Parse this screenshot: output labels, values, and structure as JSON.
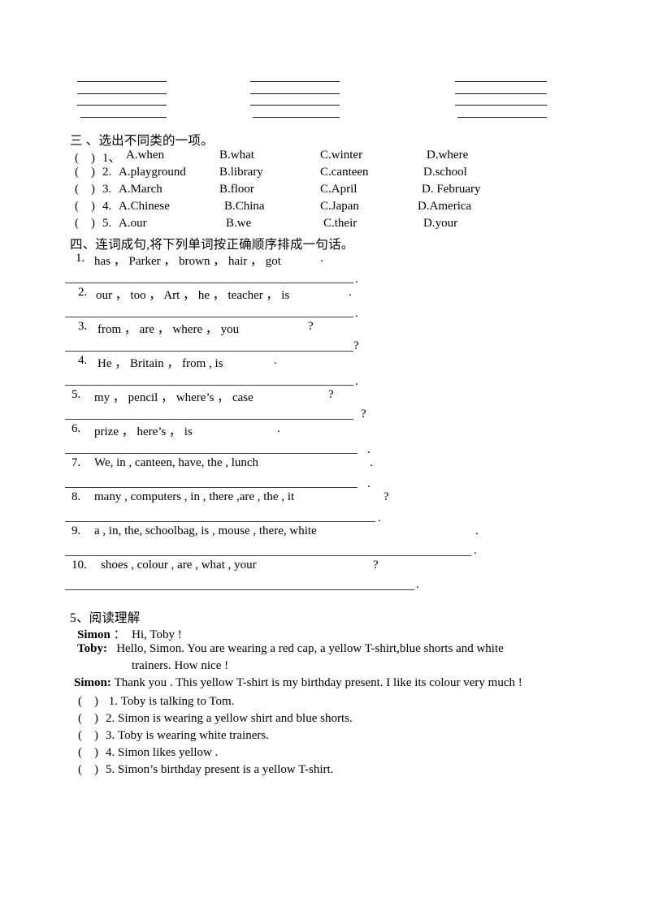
{
  "top_blank_lines": {
    "columns": 3,
    "lines_per_column": 4
  },
  "section_three": {
    "heading": "三 、选出不同类的一项。",
    "items": [
      {
        "paren": "(",
        "close": ")",
        "num": "1、",
        "options": [
          "A.when",
          "B.what",
          "C.winter",
          "D.where"
        ]
      },
      {
        "paren": "(",
        "close": ")",
        "num": "2.",
        "options": [
          "A.playground",
          "B.library",
          "C.canteen",
          "D.school"
        ]
      },
      {
        "paren": "(",
        "close": ")",
        "num": "3.",
        "options": [
          "A.March",
          "B.floor",
          "C.April",
          "D. February"
        ]
      },
      {
        "paren": "(",
        "close": ")",
        "num": "4.",
        "options": [
          "A.Chinese",
          "B.China",
          "C.Japan",
          "D.America"
        ]
      },
      {
        "paren": "(",
        "close": ")",
        "num": "5.",
        "options": [
          "A.our",
          "B.we",
          "C.their",
          "D.your"
        ]
      }
    ]
  },
  "section_four": {
    "heading": "四、连词成句,将下列单词按正确顺序排成一句话。",
    "items": [
      {
        "num": "1.",
        "words": "has ，  Parker  ，  brown  ，  hair  ，  got",
        "end": ".",
        "answer_punct": "."
      },
      {
        "num": "2.",
        "words": "our ，  too ，  Art  ， he ，  teacher ，  is",
        "end": ".",
        "answer_punct": "."
      },
      {
        "num": "3.",
        "words": "from  ，  are  ，  where ，  you",
        "end": "?",
        "answer_punct": "?"
      },
      {
        "num": "4.",
        "words": "He  ，  Britain ，  from  , is",
        "end": ".",
        "answer_punct": "."
      },
      {
        "num": "5.",
        "words": "my  ，  pencil ，  where’s  ，  case",
        "end": "?",
        "answer_punct": "?"
      },
      {
        "num": "6.",
        "words": "prize  ，  here’s  ，  is",
        "end": ".",
        "answer_punct": "."
      },
      {
        "num": "7.",
        "words": "We,  in ,  canteen,  have,  the  , lunch",
        "end": ".",
        "answer_punct": "."
      },
      {
        "num": "8.",
        "words": "many ,  computers ,  in ,  there  ,are ,  the  , it",
        "end": "?",
        "answer_punct": "."
      },
      {
        "num": "9.",
        "words": "a ,  in,  the,  schoolbag,  is  ,  mouse ,  there,  white",
        "end": ".",
        "answer_punct": "."
      },
      {
        "num": "10.",
        "words": "shoes  ,  colour  ,  are  ,  what  ,  your",
        "end": "?",
        "answer_punct": "."
      }
    ]
  },
  "section_five": {
    "heading": "5、阅读理解",
    "dialogue": [
      {
        "speaker": "Simon",
        "sep": " ：",
        "text": "Hi, Toby !"
      },
      {
        "speaker": "Toby:",
        "sep": "",
        "text": "Hello, Simon. You are wearing a red cap, a yellow T-shirt,blue shorts and white"
      },
      {
        "speaker": "",
        "sep": "",
        "text": "trainers. How nice !"
      },
      {
        "speaker": "Simon:",
        "sep": "",
        "text": "Thank you . This yellow T-shirt is my birthday present. I like its colour very much !"
      }
    ],
    "true_false": [
      {
        "paren": "(",
        "close": ")",
        "num": " 1.",
        "text": "Toby is talking to Tom."
      },
      {
        "paren": "(",
        "close": ")",
        "num": "2.",
        "text": "Simon is wearing a yellow shirt and blue shorts."
      },
      {
        "paren": "(",
        "close": ")",
        "num": "3.",
        "text": "Toby is wearing white trainers."
      },
      {
        "paren": "(",
        "close": ")",
        "num": "4.",
        "text": "Simon likes yellow ."
      },
      {
        "paren": "(",
        "close": ")",
        "num": "5.",
        "text": "Simon’s birthday present is a yellow T-shirt."
      }
    ]
  }
}
